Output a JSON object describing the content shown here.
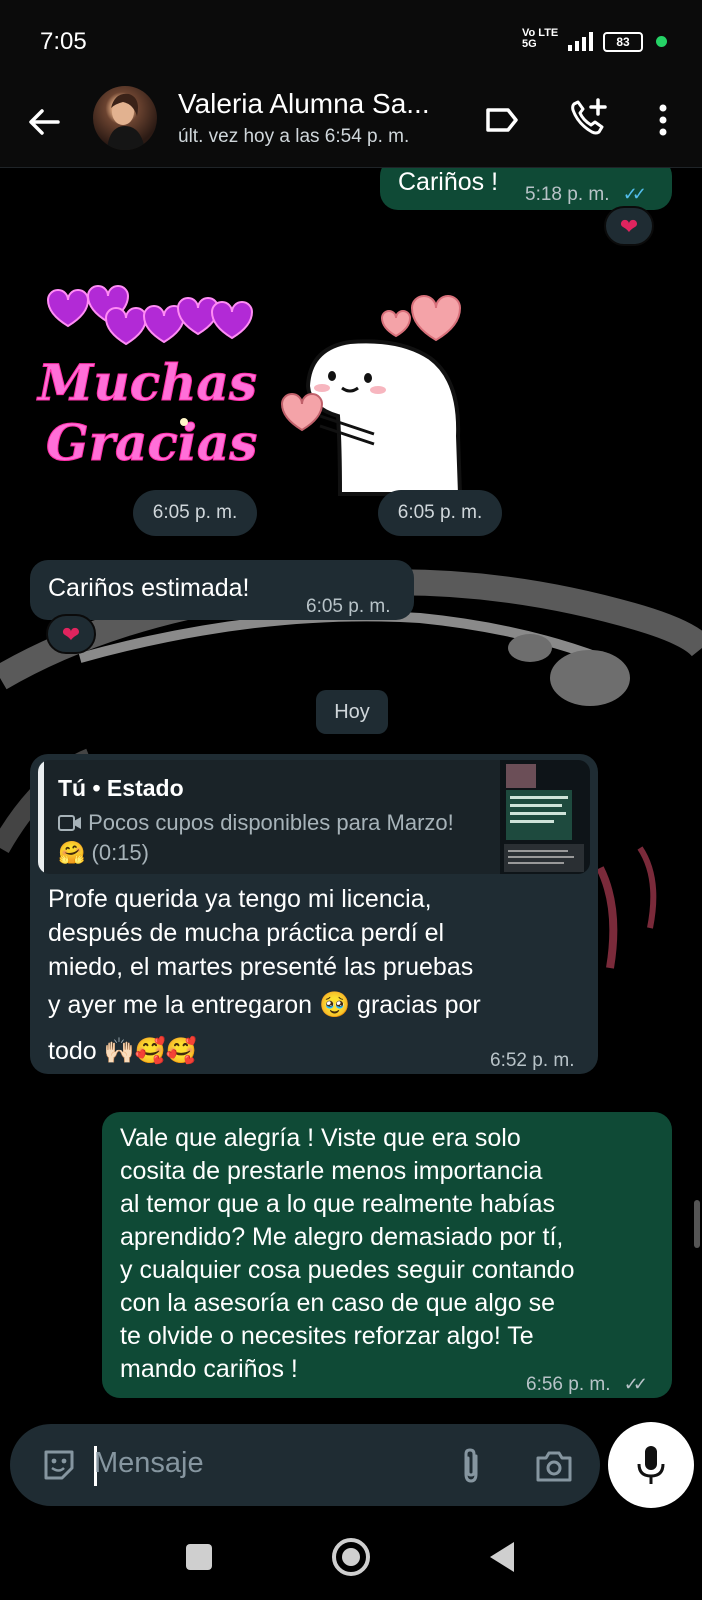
{
  "status_bar": {
    "time": "7:05",
    "network": "Vo LTE 5G",
    "battery": "83"
  },
  "header": {
    "contact_name": "Valeria Alumna Sa...",
    "last_seen": "últ. vez hoy a las 6:54 p. m."
  },
  "messages": {
    "m1": {
      "text": "Cariños !",
      "time": "5:18 p. m.",
      "ticks": "✓✓",
      "reaction": "❤"
    },
    "sticker1": {
      "line1": "Muchas",
      "line2": "Gracias",
      "time": "6:05 p. m."
    },
    "sticker2": {
      "time": "6:05 p. m."
    },
    "m2": {
      "text": "Cariños estimada!",
      "time": "6:05 p. m.",
      "reaction": "❤"
    },
    "day_chip": "Hoy",
    "m3": {
      "quote_title": "Tú • Estado",
      "quote_text": "Pocos cupos disponibles para Marzo! 🤗 (0:15)",
      "line1": "Profe querida ya tengo mi licencia,",
      "line2": "después de mucha práctica perdí el",
      "line3": "miedo, el martes presenté las pruebas",
      "line4": "y ayer me la entregaron 🥹 gracias por",
      "line5": "todo 🙌🏻🥰🥰",
      "time": "6:52 p. m."
    },
    "m4": {
      "line1": "Vale que alegría ! Viste que era solo",
      "line2": "cosita de prestarle menos importancia",
      "line3": "al temor que a lo que realmente habías",
      "line4": "aprendido? Me alegro demasiado por tí,",
      "line5": "y cualquier cosa puedes seguir contando",
      "line6": "con la asesoría en caso de que algo se",
      "line7": "te olvide o necesites reforzar algo! Te",
      "line8": "mando cariños !",
      "time": "6:56 p. m.",
      "ticks": "✓✓"
    }
  },
  "input": {
    "placeholder": "Mensaje"
  },
  "colors": {
    "outgoing_bubble": "#0f4a36",
    "incoming_bubble": "#1f2c33",
    "read_ticks": "#53bdeb",
    "sticker_pink": "#ff4fc8"
  },
  "icons": [
    "back-arrow-icon",
    "label-icon",
    "add-call-icon",
    "more-vert-icon",
    "emoji-icon",
    "attach-icon",
    "camera-icon",
    "mic-icon",
    "heart-icon"
  ]
}
